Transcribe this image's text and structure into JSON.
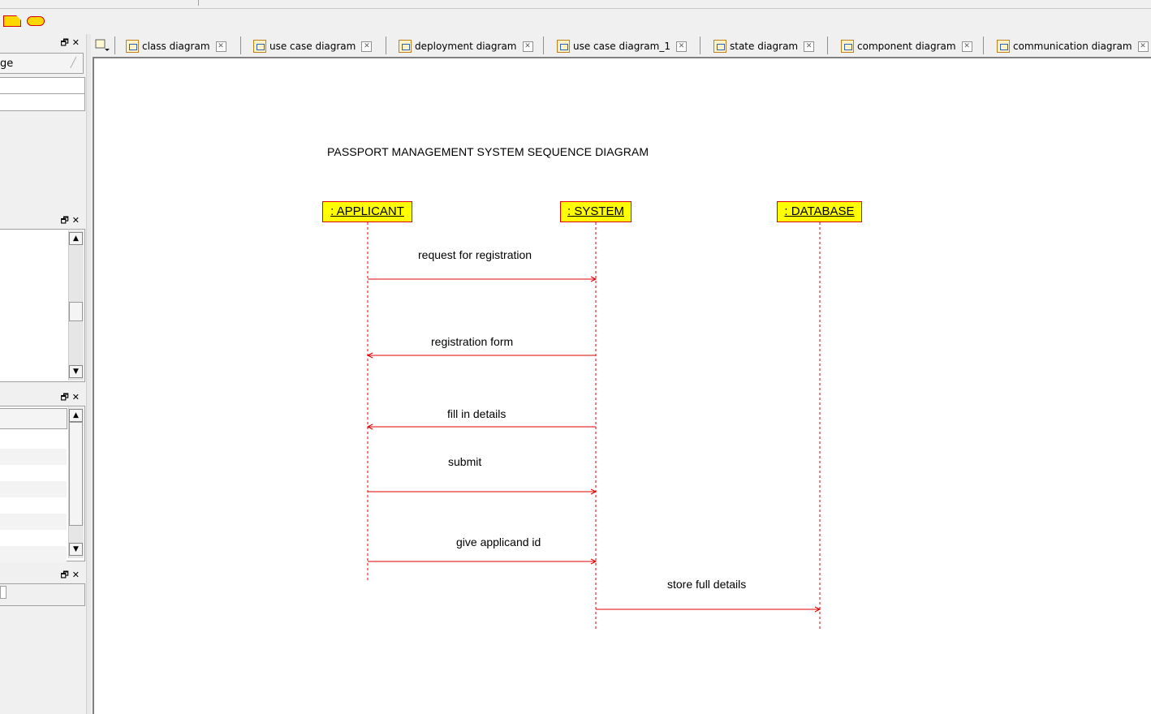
{
  "toolbar": {
    "note_icon": "note-icon",
    "oval_icon": "oval-icon"
  },
  "left_panels": {
    "panel1": {
      "header_text": "ge"
    },
    "window_buttons": {
      "restore": "🗗",
      "close": "✕"
    }
  },
  "tabs": [
    {
      "label": "class diagram",
      "icon": "class-diagram-icon"
    },
    {
      "label": "use case diagram",
      "icon": "use-case-diagram-icon"
    },
    {
      "label": "deployment diagram",
      "icon": "deployment-diagram-icon"
    },
    {
      "label": "use case diagram_1",
      "icon": "use-case-diagram-icon"
    },
    {
      "label": "state diagram",
      "icon": "state-diagram-icon"
    },
    {
      "label": "component diagram",
      "icon": "component-diagram-icon"
    },
    {
      "label": "communication diagram",
      "icon": "communication-diagram-icon"
    }
  ],
  "diagram": {
    "title": "PASSPORT MANAGEMENT SYSTEM SEQUENCE DIAGRAM",
    "lifelines": [
      {
        "label": ": APPLICANT"
      },
      {
        "label": ": SYSTEM"
      },
      {
        "label": ": DATABASE"
      }
    ],
    "messages": [
      {
        "label": "request for registration",
        "from": ": APPLICANT",
        "to": ": SYSTEM"
      },
      {
        "label": "registration form",
        "from": ": SYSTEM",
        "to": ": APPLICANT"
      },
      {
        "label": "fill in details",
        "from": ": SYSTEM",
        "to": ": APPLICANT"
      },
      {
        "label": "submit",
        "from": ": APPLICANT",
        "to": ": SYSTEM"
      },
      {
        "label": "give applicand id",
        "from": ": APPLICANT",
        "to": ": SYSTEM"
      },
      {
        "label": "store full details",
        "from": ": SYSTEM",
        "to": ": DATABASE"
      }
    ],
    "colors": {
      "lifeline_fill": "#ffff00",
      "lifeline_border": "#e00000",
      "message_line": "#e00000"
    }
  }
}
